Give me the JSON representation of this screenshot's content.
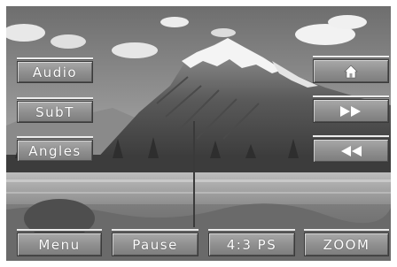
{
  "left_menu": {
    "audio_label": "Audio",
    "subtitle_label": "SubT",
    "angles_label": "Angles"
  },
  "right_menu": {
    "home_icon": "home-icon",
    "forward_icon": "fast-forward-icon",
    "rewind_icon": "rewind-icon"
  },
  "bottom_bar": {
    "menu_label": "Menu",
    "pause_label": "Pause",
    "aspect_label": "4:3 PS",
    "zoom_label": "ZOOM"
  },
  "colors": {
    "button_fill": "#8e8e8e",
    "button_text": "#ffffff",
    "button_border": "#3a3a3a"
  }
}
